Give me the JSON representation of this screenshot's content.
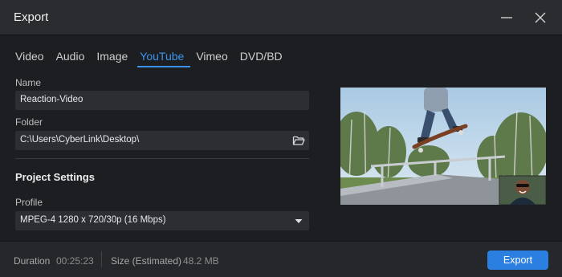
{
  "window": {
    "title": "Export",
    "minimize_icon": "minimize-icon",
    "close_icon": "close-icon"
  },
  "tabs": [
    {
      "label": "Video",
      "active": false
    },
    {
      "label": "Audio",
      "active": false
    },
    {
      "label": "Image",
      "active": false
    },
    {
      "label": "YouTube",
      "active": true
    },
    {
      "label": "Vimeo",
      "active": false
    },
    {
      "label": "DVD/BD",
      "active": false
    }
  ],
  "form": {
    "name_label": "Name",
    "name_value": "Reaction-Video",
    "folder_label": "Folder",
    "folder_value": "C:\\Users\\CyberLink\\Desktop\\",
    "folder_icon": "folder-open-icon",
    "section_title": "Project Settings",
    "profile_label": "Profile",
    "profile_value": "MPEG-4 1280 x 720/30p (16 Mbps)",
    "profile_icon": "dropdown-arrow-icon"
  },
  "preview": {
    "description_icon": "video-preview-thumbnail",
    "overlay_icon": "webcam-overlay-thumbnail"
  },
  "footer": {
    "duration_label": "Duration",
    "duration_value": "00:25:23",
    "size_label": "Size (Estimated)",
    "size_value": "48.2 MB",
    "export_label": "Export"
  },
  "colors": {
    "accent": "#3b94ec",
    "button": "#2a7fe0",
    "background": "#1c1e22",
    "field": "#2c2e33"
  }
}
